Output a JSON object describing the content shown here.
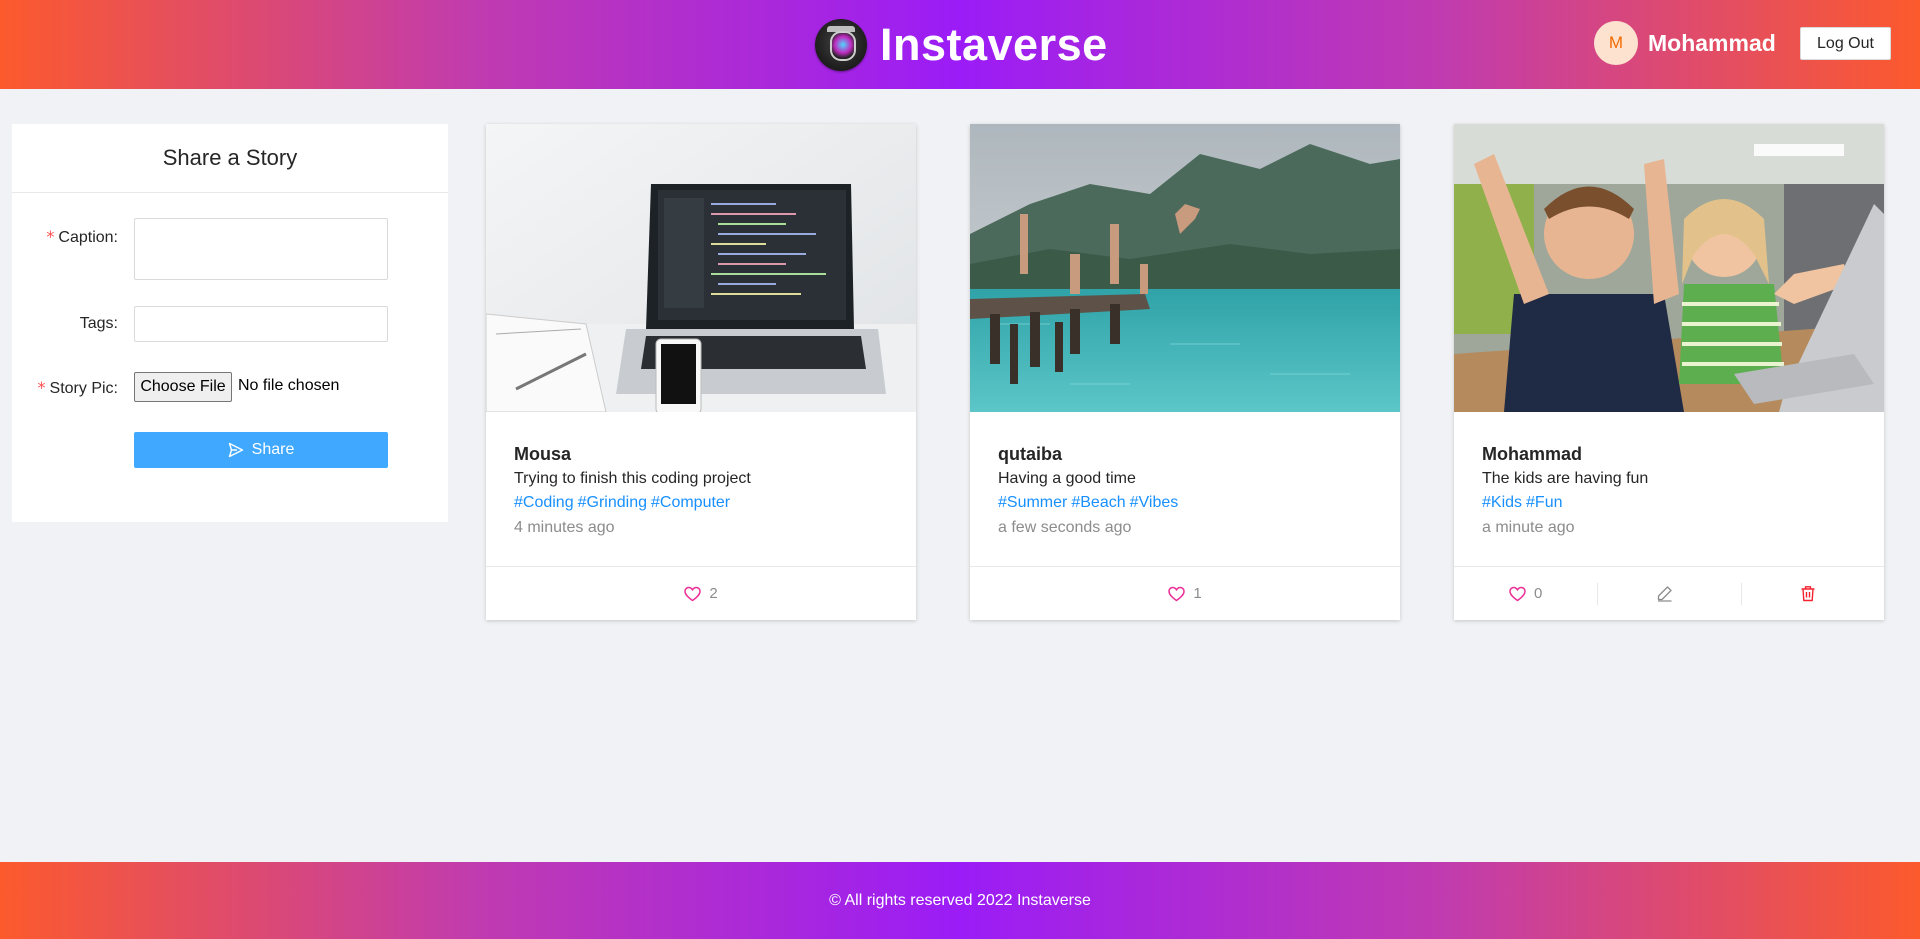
{
  "header": {
    "brand": "Instaverse",
    "user_initial": "M",
    "username": "Mohammad",
    "logout_label": "Log Out"
  },
  "share_form": {
    "title": "Share a Story",
    "caption_label": "Caption",
    "tags_label": "Tags",
    "story_pic_label": "Story Pic",
    "choose_file_label": "Choose File",
    "no_file_text": "No file chosen",
    "share_label": "Share"
  },
  "stories": [
    {
      "author": "Mousa",
      "caption": "Trying to finish this coding project",
      "tags": [
        "#Coding",
        "#Grinding",
        "#Computer"
      ],
      "time": "4 minutes ago",
      "likes": "2",
      "image": "laptop on desk with code editor",
      "owned": false
    },
    {
      "author": "qutaiba",
      "caption": "Having a good time",
      "tags": [
        "#Summer",
        "#Beach",
        "#Vibes"
      ],
      "time": "a few seconds ago",
      "likes": "1",
      "image": "people jumping off a pier into the sea",
      "owned": false
    },
    {
      "author": "Mohammad",
      "caption": "The kids are having fun",
      "tags": [
        "#Kids",
        "#Fun"
      ],
      "time": "a minute ago",
      "likes": "0",
      "image": "two excited kids in front of a laptop",
      "owned": true
    }
  ],
  "footer": {
    "text": "© All rights reserved 2022 Instaverse"
  },
  "colors": {
    "gradient_edge": "#fc5a2c",
    "gradient_center": "#9b1cf7",
    "primary": "#40a9ff",
    "tag": "#1890ff",
    "like_icon": "#eb2f96",
    "delete_icon": "#f5222d"
  }
}
